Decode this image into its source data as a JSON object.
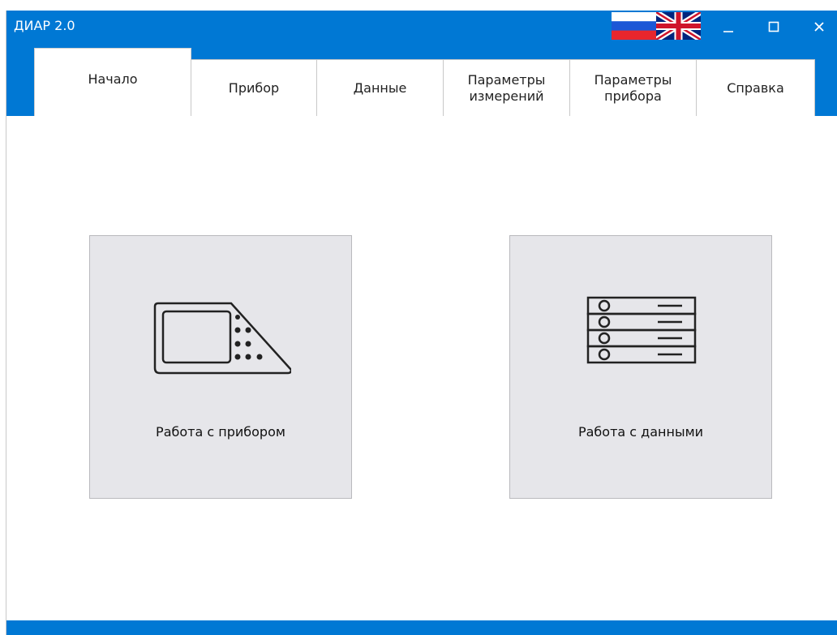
{
  "window": {
    "title": "ДИАР 2.0"
  },
  "languages": [
    {
      "code": "ru",
      "icon": "russia-flag-icon"
    },
    {
      "code": "en",
      "icon": "uk-flag-icon"
    }
  ],
  "window_controls": {
    "minimize": "minimize-icon",
    "maximize": "maximize-icon",
    "close": "close-icon"
  },
  "tabs": [
    {
      "label": "Начало",
      "active": true
    },
    {
      "label": "Прибор"
    },
    {
      "label": "Данные"
    },
    {
      "label": "Параметры измерений"
    },
    {
      "label": "Параметры прибора"
    },
    {
      "label": "Справка"
    }
  ],
  "tiles": {
    "device": {
      "label": "Работа с прибором",
      "icon": "device-icon"
    },
    "data": {
      "label": "Работа с данными",
      "icon": "database-icon"
    }
  },
  "colors": {
    "accent": "#0078d4",
    "tile_bg": "#e6e6ea"
  }
}
